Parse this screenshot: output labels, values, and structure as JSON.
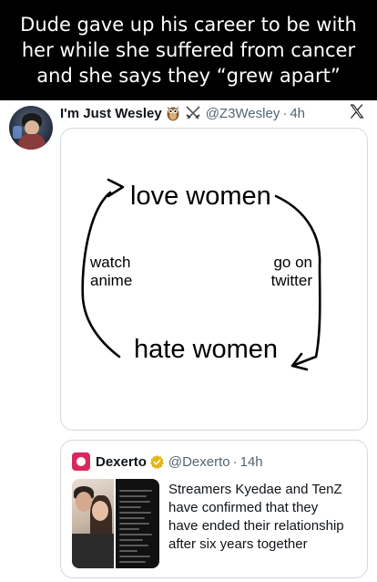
{
  "banner": {
    "caption": "Dude gave up his career to be with\nher while she suffered from cancer\nand she says they “grew apart”"
  },
  "tweet": {
    "display_name": "I'm Just Wesley",
    "emojis": [
      "owl-emoji",
      "crossed-swords-emoji"
    ],
    "handle": "@Z3Wesley",
    "separator": "·",
    "time": "4h",
    "platform_icon": "x-logo-icon"
  },
  "diagram": {
    "top": "love women",
    "bottom": "hate women",
    "left": "watch\nanime",
    "right": "go on\ntwitter"
  },
  "quoted_tweet": {
    "display_name": "Dexerto",
    "verified": true,
    "handle": "@Dexerto",
    "separator": "·",
    "time": "14h",
    "text": "Streamers Kyedae and TenZ\nhave confirmed that they\nhave ended their relationship\nafter six years together"
  },
  "colors": {
    "text_primary": "#0f1419",
    "text_secondary": "#536471",
    "border": "#cfd9de",
    "verified_gold": "#e2b719",
    "dexerto_brand": "#d9285e"
  }
}
